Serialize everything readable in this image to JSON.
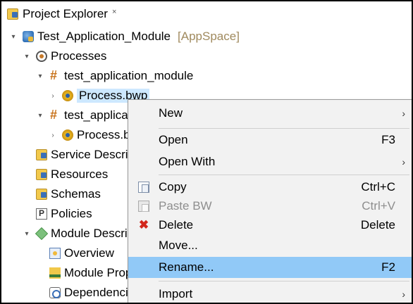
{
  "view": {
    "title": "Project Explorer",
    "close_symbol": "×"
  },
  "tree": [
    {
      "label": "Test_Application_Module",
      "decoration": "[AppSpace]",
      "icon": "module-icon",
      "twisty": "▾"
    },
    {
      "label": "Processes",
      "icon": "processes-icon",
      "twisty": "▾"
    },
    {
      "label": "test_application_module",
      "icon": "package-icon",
      "twisty": "▾"
    },
    {
      "label": "Process.bwp",
      "icon": "process-icon",
      "twisty": "›"
    },
    {
      "label": "test_application_module",
      "icon": "package-icon",
      "twisty": "▾"
    },
    {
      "label": "Process.bwp",
      "icon": "process-icon",
      "twisty": "›"
    },
    {
      "label": "Service Descriptors",
      "icon": "folder-icon"
    },
    {
      "label": "Resources",
      "icon": "folder-icon"
    },
    {
      "label": "Schemas",
      "icon": "folder-icon"
    },
    {
      "label": "Policies",
      "icon": "policy-icon"
    },
    {
      "label": "Module Descriptors",
      "icon": "descriptor-icon",
      "twisty": "▾"
    },
    {
      "label": "Overview",
      "icon": "overview-icon"
    },
    {
      "label": "Module Properties",
      "icon": "module-properties-icon"
    },
    {
      "label": "Dependencies",
      "icon": "dependencies-icon"
    }
  ],
  "context_menu": {
    "new": {
      "label": "New",
      "arrow": "›"
    },
    "open": {
      "label": "Open",
      "shortcut": "F3"
    },
    "open_with": {
      "label": "Open With",
      "arrow": "›"
    },
    "copy": {
      "label": "Copy",
      "shortcut": "Ctrl+C",
      "icon": "copy-icon"
    },
    "paste": {
      "label": "Paste BW",
      "shortcut": "Ctrl+V",
      "icon": "paste-icon",
      "disabled": true
    },
    "delete": {
      "label": "Delete",
      "shortcut": "Delete",
      "icon": "delete-icon",
      "glyph": "✖"
    },
    "move": {
      "label": "Move..."
    },
    "rename": {
      "label": "Rename...",
      "shortcut": "F2",
      "highlighted": true
    },
    "import": {
      "label": "Import",
      "arrow": "›"
    }
  },
  "colors": {
    "selection": "#cde8ff",
    "menu_hover": "#91c9f7",
    "menu_background": "#f2f2f2",
    "decoration": "#a08a5e",
    "delete_icon": "#d2261c"
  }
}
